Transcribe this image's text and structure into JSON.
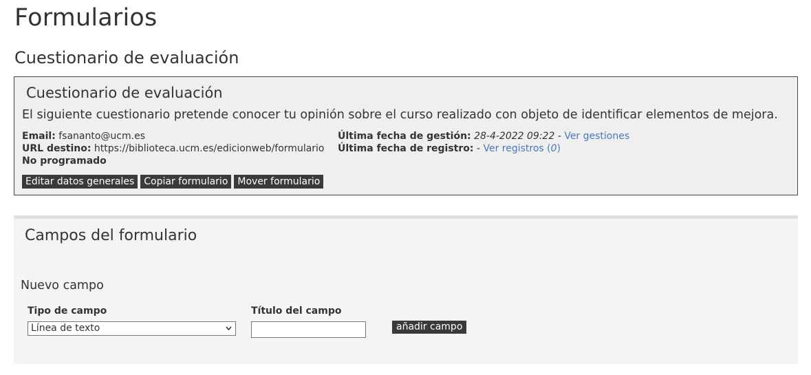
{
  "page": {
    "title": "Formularios",
    "subtitle": "Cuestionario de evaluación"
  },
  "form_box": {
    "title": "Cuestionario de evaluación",
    "description": "El siguiente cuestionario pretende conocer tu opinión sobre el curso realizado con objeto de identificar elementos de mejora.",
    "email_label": "Email:",
    "email_value": "fsananto@ucm.es",
    "url_label": "URL destino:",
    "url_value": "https://biblioteca.ucm.es/edicionweb/formulario",
    "schedule_status": "No programado",
    "last_management_label": "Última fecha de gestión:",
    "last_management_value": "28-4-2022 09:22",
    "dash1": "-",
    "view_management_link": "Ver gestiones",
    "last_record_label": "Última fecha de registro:",
    "dash2": "-",
    "view_records_link": "Ver registros (",
    "records_count": "0",
    "records_close": ")",
    "buttons": {
      "edit": "Editar datos generales",
      "copy": "Copiar formulario",
      "move": "Mover formulario"
    }
  },
  "fields_section": {
    "title": "Campos del formulario",
    "new_field_title": "Nuevo campo",
    "field_type_label": "Tipo de campo",
    "field_type_selected": "Línea de texto",
    "field_title_label": "Título del campo",
    "field_title_value": "",
    "add_button": "añadir campo"
  },
  "colors": {
    "button_bg": "#3a3a3a",
    "link": "#4a78b8",
    "box_bg": "#efefef",
    "section_bg": "#f4f4f4"
  }
}
